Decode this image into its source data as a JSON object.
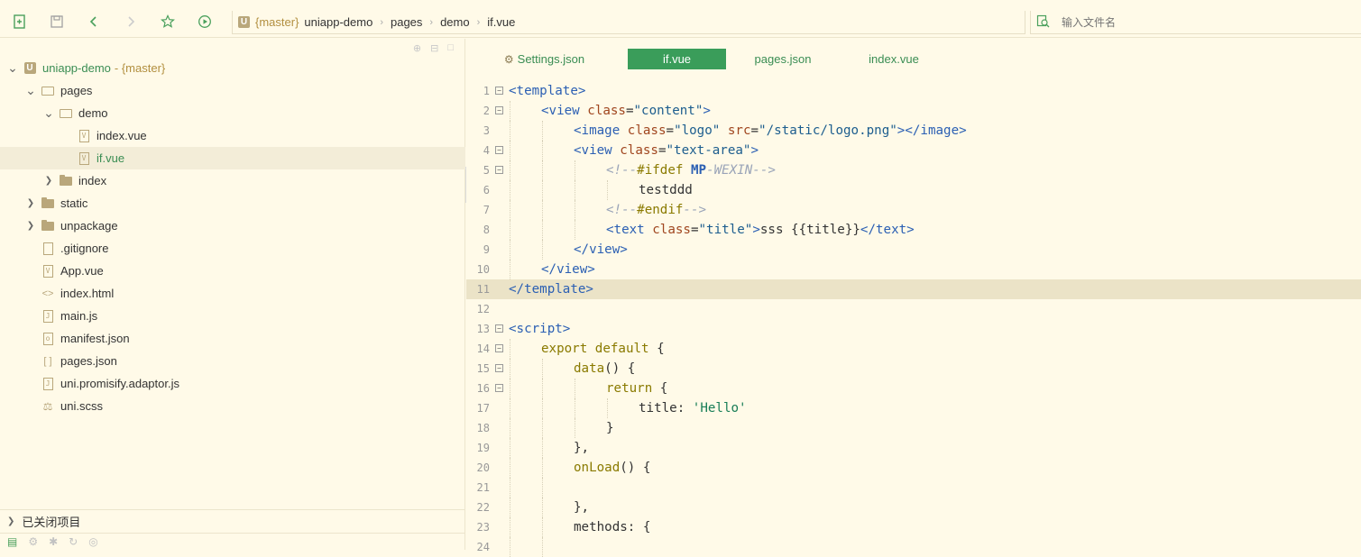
{
  "toolbar": {
    "breadcrumb": {
      "logo": "U",
      "branch": "{master}",
      "parts": [
        "uniapp-demo",
        "pages",
        "demo",
        "if.vue"
      ]
    },
    "search_placeholder": "输入文件名"
  },
  "sidebar": {
    "tree": [
      {
        "label": "uniapp-demo",
        "branch": "- {master}",
        "type": "root",
        "expanded": true,
        "depth": 0
      },
      {
        "label": "pages",
        "type": "folder",
        "expanded": true,
        "depth": 1
      },
      {
        "label": "demo",
        "type": "folder",
        "expanded": true,
        "depth": 2
      },
      {
        "label": "index.vue",
        "type": "file",
        "glyph": "V",
        "depth": 3
      },
      {
        "label": "if.vue",
        "type": "file",
        "glyph": "V",
        "depth": 3,
        "selected": true
      },
      {
        "label": "index",
        "type": "folder",
        "expanded": false,
        "depth": 2
      },
      {
        "label": "static",
        "type": "folder",
        "expanded": false,
        "depth": 1
      },
      {
        "label": "unpackage",
        "type": "folder",
        "expanded": false,
        "depth": 1
      },
      {
        "label": ".gitignore",
        "type": "file",
        "glyph": "",
        "depth": 1
      },
      {
        "label": "App.vue",
        "type": "file",
        "glyph": "V",
        "depth": 1
      },
      {
        "label": "index.html",
        "type": "file",
        "glyph": "<>",
        "depth": 1
      },
      {
        "label": "main.js",
        "type": "file",
        "glyph": "J",
        "depth": 1
      },
      {
        "label": "manifest.json",
        "type": "file",
        "glyph": "{o}",
        "depth": 1
      },
      {
        "label": "pages.json",
        "type": "file",
        "glyph": "[ ]",
        "depth": 1
      },
      {
        "label": "uni.promisify.adaptor.js",
        "type": "file",
        "glyph": "J",
        "depth": 1
      },
      {
        "label": "uni.scss",
        "type": "file",
        "glyph": "S",
        "depth": 1
      }
    ],
    "closed_projects": "已关闭项目"
  },
  "editor": {
    "tabs": [
      {
        "label": "Settings.json",
        "active": false,
        "gear": true
      },
      {
        "label": "if.vue",
        "active": true
      },
      {
        "label": "pages.json",
        "active": false
      },
      {
        "label": "index.vue",
        "active": false
      }
    ],
    "highlight_line": 11,
    "lines": [
      {
        "n": "1",
        "fold": true,
        "indent": 0,
        "tokens": [
          [
            "tag",
            "<template>"
          ]
        ]
      },
      {
        "n": "2",
        "fold": true,
        "indent": 1,
        "tokens": [
          [
            "tag",
            "<view "
          ],
          [
            "attr",
            "class"
          ],
          [
            "plain",
            "="
          ],
          [
            "str",
            "\"content\""
          ],
          [
            "tag",
            ">"
          ]
        ]
      },
      {
        "n": "3",
        "fold": false,
        "indent": 2,
        "tokens": [
          [
            "tag",
            "<image "
          ],
          [
            "attr",
            "class"
          ],
          [
            "plain",
            "="
          ],
          [
            "str",
            "\"logo\""
          ],
          [
            "plain",
            " "
          ],
          [
            "attr",
            "src"
          ],
          [
            "plain",
            "="
          ],
          [
            "str",
            "\"/static/logo.png\""
          ],
          [
            "tag",
            "></image>"
          ]
        ]
      },
      {
        "n": "4",
        "fold": true,
        "indent": 2,
        "tokens": [
          [
            "tag",
            "<view "
          ],
          [
            "attr",
            "class"
          ],
          [
            "plain",
            "="
          ],
          [
            "str",
            "\"text-area\""
          ],
          [
            "tag",
            ">"
          ]
        ]
      },
      {
        "n": "5",
        "fold": true,
        "indent": 3,
        "tokens": [
          [
            "com",
            "<!--"
          ],
          [
            "kw",
            "#ifdef "
          ],
          [
            "bold",
            "MP"
          ],
          [
            "com",
            "-WEXIN-->"
          ]
        ]
      },
      {
        "n": "6",
        "fold": false,
        "indent": 4,
        "tokens": [
          [
            "plain",
            "testddd"
          ]
        ]
      },
      {
        "n": "7",
        "fold": false,
        "indent": 3,
        "tokens": [
          [
            "com",
            "<!--"
          ],
          [
            "kw",
            "#endif"
          ],
          [
            "com",
            "-->"
          ]
        ]
      },
      {
        "n": "8",
        "fold": false,
        "indent": 3,
        "tokens": [
          [
            "tag",
            "<text "
          ],
          [
            "attr",
            "class"
          ],
          [
            "plain",
            "="
          ],
          [
            "str",
            "\"title\""
          ],
          [
            "tag",
            ">"
          ],
          [
            "plain",
            "sss {{title}}"
          ],
          [
            "tag",
            "</text>"
          ]
        ]
      },
      {
        "n": "9",
        "fold": false,
        "indent": 2,
        "tokens": [
          [
            "tag",
            "</view>"
          ]
        ]
      },
      {
        "n": "10",
        "fold": false,
        "indent": 1,
        "tokens": [
          [
            "tag",
            "</view>"
          ]
        ]
      },
      {
        "n": "11",
        "fold": false,
        "indent": 0,
        "tokens": [
          [
            "tag",
            "</template>"
          ]
        ]
      },
      {
        "n": "12",
        "fold": false,
        "indent": 0,
        "tokens": []
      },
      {
        "n": "13",
        "fold": true,
        "indent": 0,
        "tokens": [
          [
            "tag",
            "<script>"
          ]
        ]
      },
      {
        "n": "14",
        "fold": true,
        "indent": 1,
        "tokens": [
          [
            "kw",
            "export default"
          ],
          [
            "plain",
            " {"
          ]
        ]
      },
      {
        "n": "15",
        "fold": true,
        "indent": 2,
        "tokens": [
          [
            "fn",
            "data"
          ],
          [
            "plain",
            "() {"
          ]
        ]
      },
      {
        "n": "16",
        "fold": true,
        "indent": 3,
        "tokens": [
          [
            "kw",
            "return"
          ],
          [
            "plain",
            " {"
          ]
        ]
      },
      {
        "n": "17",
        "fold": false,
        "indent": 4,
        "tokens": [
          [
            "plain",
            "title: "
          ],
          [
            "strg",
            "'Hello'"
          ]
        ]
      },
      {
        "n": "18",
        "fold": false,
        "indent": 3,
        "tokens": [
          [
            "plain",
            "}"
          ]
        ]
      },
      {
        "n": "19",
        "fold": false,
        "indent": 2,
        "tokens": [
          [
            "plain",
            "},"
          ]
        ]
      },
      {
        "n": "20",
        "fold": false,
        "indent": 2,
        "tokens": [
          [
            "fn",
            "onLoad"
          ],
          [
            "plain",
            "() {"
          ]
        ]
      },
      {
        "n": "21",
        "fold": false,
        "indent": 2,
        "tokens": []
      },
      {
        "n": "22",
        "fold": false,
        "indent": 2,
        "tokens": [
          [
            "plain",
            "},"
          ]
        ]
      },
      {
        "n": "23",
        "fold": false,
        "indent": 2,
        "tokens": [
          [
            "plain",
            "methods: {"
          ]
        ]
      },
      {
        "n": "24",
        "fold": false,
        "indent": 2,
        "tokens": []
      }
    ]
  }
}
